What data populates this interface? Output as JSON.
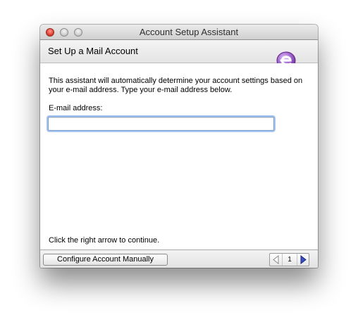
{
  "window": {
    "title": "Account Setup Assistant",
    "controls": {
      "close": "close-button",
      "minimize": "minimize-button",
      "zoom": "zoom-button"
    }
  },
  "header": {
    "title": "Set Up a Mail Account",
    "logo_icon": "entourage-logo-icon"
  },
  "content": {
    "intro": "This assistant will automatically determine your account settings based on your e-mail address. Type your e-mail address below.",
    "email_label": "E-mail address:",
    "email_value": "",
    "continue_hint": "Click the right arrow to continue."
  },
  "footer": {
    "manual_button_label": "Configure Account Manually",
    "page_number": "1",
    "prev_icon": "left-arrow-icon",
    "next_icon": "right-arrow-icon"
  },
  "colors": {
    "focus_ring": "#a7c5ee",
    "logo_purple": "#8a4bb8",
    "next_arrow": "#2f3fa8",
    "close_red": "#e2453a"
  }
}
